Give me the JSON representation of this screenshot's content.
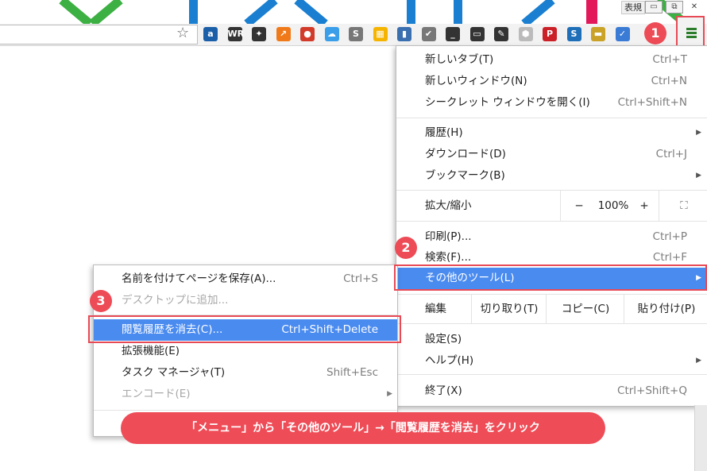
{
  "window": {
    "user_badge": "表規",
    "minimize_glyph": "▭",
    "restore_glyph": "⧉",
    "close_glyph": "✕"
  },
  "toolbar": {
    "star_glyph": "☆",
    "extensions": [
      {
        "name": "a-icon",
        "text": "a",
        "color": "#1a5fa8"
      },
      {
        "name": "wr-icon",
        "text": "WR",
        "color": "#333333"
      },
      {
        "name": "puzzle-icon",
        "text": "✦",
        "color": "#333333"
      },
      {
        "name": "chart-up-icon",
        "text": "↗",
        "color": "#f07a1a"
      },
      {
        "name": "color-ball-icon",
        "text": "●",
        "color": "#d23a2a"
      },
      {
        "name": "cloud-icon",
        "text": "☁",
        "color": "#3a9ee8"
      },
      {
        "name": "s-circle-icon",
        "text": "S",
        "color": "#777777"
      },
      {
        "name": "stocks-icon",
        "text": "▦",
        "color": "#f5b400"
      },
      {
        "name": "bar-chart-icon",
        "text": "▮",
        "color": "#3a6fb0"
      },
      {
        "name": "check-circle-icon",
        "text": "✔",
        "color": "#777777"
      },
      {
        "name": "underline-icon",
        "text": "_",
        "color": "#333333"
      },
      {
        "name": "truck-icon",
        "text": "▭",
        "color": "#333333"
      },
      {
        "name": "signature-icon",
        "text": "✎",
        "color": "#333333"
      },
      {
        "name": "shield-icon",
        "text": "⬢",
        "color": "#bbbbbb"
      },
      {
        "name": "pinterest-icon",
        "text": "P",
        "color": "#cb2027"
      },
      {
        "name": "s-square-icon",
        "text": "S",
        "color": "#1e6fb8"
      },
      {
        "name": "ruler-icon",
        "text": "▬",
        "color": "#c9a227"
      },
      {
        "name": "checkbox-icon",
        "text": "✓",
        "color": "#3a7bd5"
      }
    ]
  },
  "main_menu": {
    "new_tab": {
      "label": "新しいタブ(T)",
      "shortcut": "Ctrl+T"
    },
    "new_window": {
      "label": "新しいウィンドウ(N)",
      "shortcut": "Ctrl+N"
    },
    "incognito": {
      "label": "シークレット ウィンドウを開く(I)",
      "shortcut": "Ctrl+Shift+N"
    },
    "history": {
      "label": "履歴(H)"
    },
    "downloads": {
      "label": "ダウンロード(D)",
      "shortcut": "Ctrl+J"
    },
    "bookmarks": {
      "label": "ブックマーク(B)"
    },
    "zoom": {
      "label": "拡大/縮小",
      "minus": "−",
      "value": "100%",
      "plus": "+",
      "fullscreen": "⛶"
    },
    "print": {
      "label": "印刷(P)...",
      "shortcut": "Ctrl+P"
    },
    "find": {
      "label": "検索(F)...",
      "shortcut": "Ctrl+F"
    },
    "more_tools": {
      "label": "その他のツール(L)"
    },
    "edit": {
      "label": "編集",
      "cut": "切り取り(T)",
      "copy": "コピー(C)",
      "paste": "貼り付け(P)"
    },
    "settings": {
      "label": "設定(S)"
    },
    "help": {
      "label": "ヘルプ(H)"
    },
    "exit": {
      "label": "終了(X)",
      "shortcut": "Ctrl+Shift+Q"
    },
    "arrow": "▶"
  },
  "submenu": {
    "save_page": {
      "label": "名前を付けてページを保存(A)...",
      "shortcut": "Ctrl+S"
    },
    "add_desktop": {
      "label": "デスクトップに追加..."
    },
    "clear_history": {
      "label": "閲覧履歴を消去(C)...",
      "shortcut": "Ctrl+Shift+Delete"
    },
    "extensions": {
      "label": "拡張機能(E)"
    },
    "task_manager": {
      "label": "タスク マネージャ(T)",
      "shortcut": "Shift+Esc"
    },
    "encoding": {
      "label": "エンコード(E)"
    }
  },
  "callouts": {
    "step1": "1",
    "step2": "2",
    "step3": "3",
    "banner": "「メニュー」から「その他のツール」→「閲覧履歴を消去」をクリック"
  },
  "colors": {
    "highlight": "#4a8bf0",
    "callout_red": "#ee4c57",
    "stripe_green": "#3cb043",
    "stripe_blue": "#1a7fd0",
    "stripe_pink": "#e2185b"
  }
}
